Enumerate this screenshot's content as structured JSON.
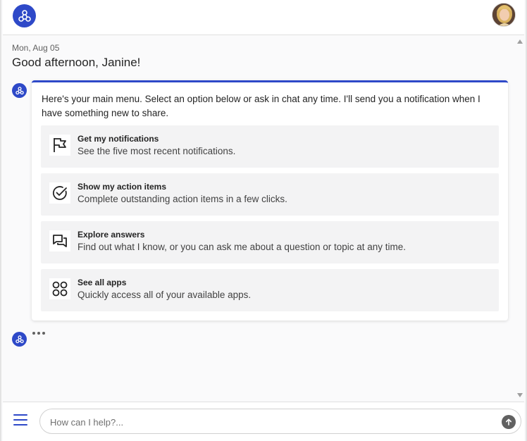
{
  "header": {
    "logo_icon": "network-nodes-icon",
    "avatar_icon": "user-avatar",
    "brand_color": "#2e49c8"
  },
  "chat": {
    "date": "Mon, Aug 05",
    "greeting": "Good afternoon, Janine!",
    "card": {
      "intro": "Here's your main menu. Select an option below or ask in chat any time. I'll send you a notification when I have something new to share.",
      "options": [
        {
          "icon": "flag-icon",
          "title": "Get my notifications",
          "description": "See the five most recent notifications."
        },
        {
          "icon": "check-circle-icon",
          "title": "Show my action items",
          "description": "Complete outstanding action items in a few clicks."
        },
        {
          "icon": "chat-bubbles-icon",
          "title": "Explore answers",
          "description": "Find out what I know, or you can ask me about a question or topic at any time."
        },
        {
          "icon": "apps-grid-icon",
          "title": "See all apps",
          "description": "Quickly access all of your available apps."
        }
      ]
    }
  },
  "composer": {
    "menu_icon": "hamburger-menu-icon",
    "placeholder": "How can I help?...",
    "value": "",
    "send_icon": "arrow-up-icon"
  }
}
